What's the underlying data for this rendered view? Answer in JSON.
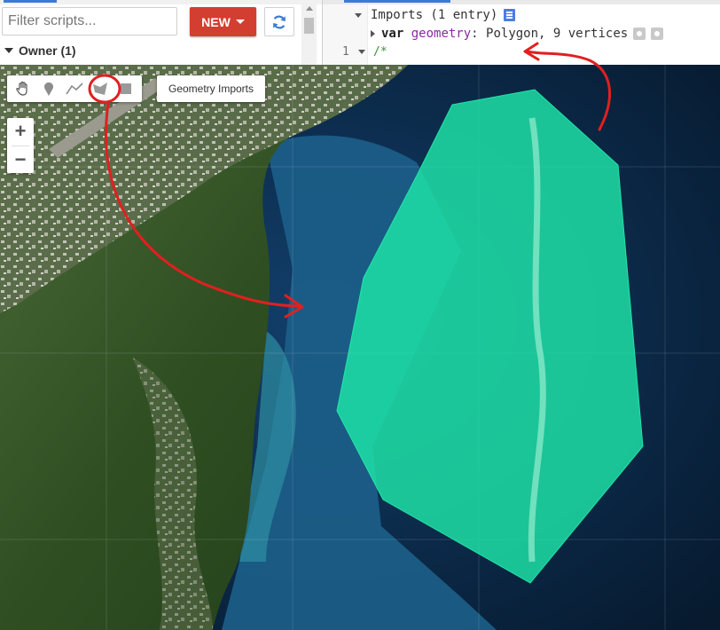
{
  "scripts_panel": {
    "filter_placeholder": "Filter scripts...",
    "new_button_label": "NEW",
    "owner_group_label": "Owner (1)"
  },
  "editor": {
    "imports_header": "Imports (1 entry)",
    "import_keyword": "var",
    "import_name": "geometry",
    "import_rest": ": Polygon, 9 vertices",
    "line_number": "1",
    "line_1_code": "/*"
  },
  "map": {
    "toolbar_tools": [
      "hand-icon",
      "marker-icon",
      "line-icon",
      "polygon-icon",
      "rectangle-icon"
    ],
    "geometry_imports_label": "Geometry Imports",
    "zoom_in_label": "+",
    "zoom_out_label": "−",
    "polygon_color": "#1fe6a8"
  },
  "colors": {
    "new_button": "#d23f31",
    "annotation": "#e02020",
    "accent_blue": "#3a7bd5"
  }
}
